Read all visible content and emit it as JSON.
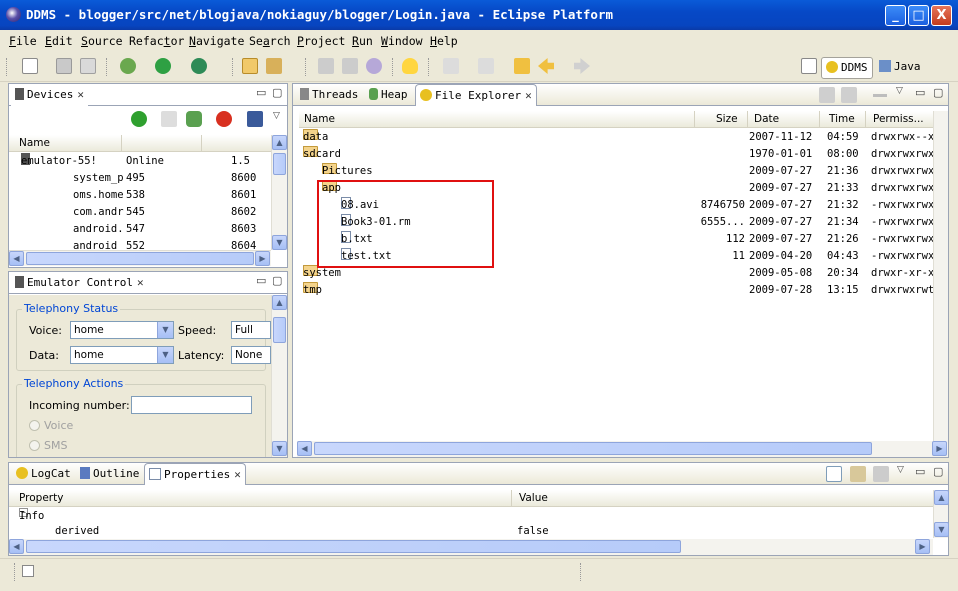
{
  "window": {
    "title": "DDMS - blogger/src/net/blogjava/nokiaguy/blogger/Login.java - Eclipse Platform",
    "min": "_",
    "max": "□",
    "close": "X"
  },
  "menu": [
    {
      "u": "F",
      "rest": "ile"
    },
    {
      "u": "E",
      "rest": "dit"
    },
    {
      "u": "S",
      "rest": "ource"
    },
    {
      "u": "",
      "pre": "Refac",
      "uu": "t",
      "post": "or"
    },
    {
      "u": "N",
      "rest": "avigate"
    },
    {
      "u": "",
      "pre": "Se",
      "uu": "a",
      "post": "rch"
    },
    {
      "u": "P",
      "rest": "roject"
    },
    {
      "u": "R",
      "rest": "un"
    },
    {
      "u": "W",
      "rest": "indow"
    },
    {
      "u": "H",
      "rest": "elp"
    }
  ],
  "perspectives": {
    "ddms": "DDMS",
    "java": "Java"
  },
  "devices": {
    "tab": "Devices",
    "col_name": "Name",
    "rows": [
      {
        "name": "emulator-55!",
        "c2": "Online",
        "c3": "1.5"
      },
      {
        "name": "system_p",
        "c2": "495",
        "c3": "8600"
      },
      {
        "name": "oms.home",
        "c2": "538",
        "c3": "8601"
      },
      {
        "name": "com.andr",
        "c2": "545",
        "c3": "8602"
      },
      {
        "name": "android.",
        "c2": "547",
        "c3": "8603"
      },
      {
        "name": "android",
        "c2": "552",
        "c3": "8604"
      }
    ]
  },
  "emulator": {
    "tab": "Emulator Control",
    "telephony_status": "Telephony Status",
    "voice_label": "Voice:",
    "voice_value": "home",
    "speed_label": "Speed:",
    "speed_value": "Full",
    "data_label": "Data:",
    "data_value": "home",
    "latency_label": "Latency:",
    "latency_value": "None",
    "telephony_actions": "Telephony Actions",
    "incoming_label": "Incoming number:",
    "incoming_value": "",
    "radio_voice": "Voice",
    "radio_sms": "SMS"
  },
  "explorer": {
    "tabs": {
      "threads": "Threads",
      "heap": "Heap",
      "file_explorer": "File Explorer"
    },
    "cols": {
      "name": "Name",
      "size": "Size",
      "date": "Date",
      "time": "Time",
      "perm": "Permiss..."
    },
    "rows": [
      {
        "name": "data",
        "type": "folder",
        "lvl": 0,
        "exp": "+",
        "size": "",
        "date": "2007-11-12",
        "time": "04:59",
        "perm": "drwxrwx--x"
      },
      {
        "name": "sdcard",
        "type": "folder",
        "lvl": 0,
        "exp": "-",
        "size": "",
        "date": "1970-01-01",
        "time": "08:00",
        "perm": "drwxrwxrwx"
      },
      {
        "name": "Pictures",
        "type": "folder",
        "lvl": 1,
        "exp": "+",
        "size": "",
        "date": "2009-07-27",
        "time": "21:36",
        "perm": "drwxrwxrwx"
      },
      {
        "name": "app",
        "type": "folder",
        "lvl": 1,
        "exp": "-",
        "size": "",
        "date": "2009-07-27",
        "time": "21:33",
        "perm": "drwxrwxrwx"
      },
      {
        "name": "08.avi",
        "type": "file",
        "lvl": 2,
        "exp": "",
        "size": "8746750",
        "date": "2009-07-27",
        "time": "21:32",
        "perm": "-rwxrwxrwx"
      },
      {
        "name": "Book3-01.rm",
        "type": "file",
        "lvl": 2,
        "exp": "",
        "size": "6555...",
        "date": "2009-07-27",
        "time": "21:34",
        "perm": "-rwxrwxrwx"
      },
      {
        "name": "b.txt",
        "type": "file",
        "lvl": 2,
        "exp": "",
        "size": "112",
        "date": "2009-07-27",
        "time": "21:26",
        "perm": "-rwxrwxrwx"
      },
      {
        "name": "test.txt",
        "type": "file",
        "lvl": 2,
        "exp": "",
        "size": "11",
        "date": "2009-04-20",
        "time": "04:43",
        "perm": "-rwxrwxrwx"
      },
      {
        "name": "system",
        "type": "folder",
        "lvl": 0,
        "exp": "+",
        "size": "",
        "date": "2009-05-08",
        "time": "20:34",
        "perm": "drwxr-xr-x"
      },
      {
        "name": "tmp",
        "type": "folder",
        "lvl": 0,
        "exp": "+",
        "size": "",
        "date": "2009-07-28",
        "time": "13:15",
        "perm": "drwxrwxrwt"
      }
    ]
  },
  "bottom": {
    "tabs": {
      "logcat": "LogCat",
      "outline": "Outline",
      "properties": "Properties"
    },
    "col_property": "Property",
    "col_value": "Value",
    "group": "Info",
    "prop_name": "derived",
    "prop_value": "false"
  },
  "colors": {
    "highlight": "#e01010",
    "title_bg": "#0a5bd8"
  }
}
